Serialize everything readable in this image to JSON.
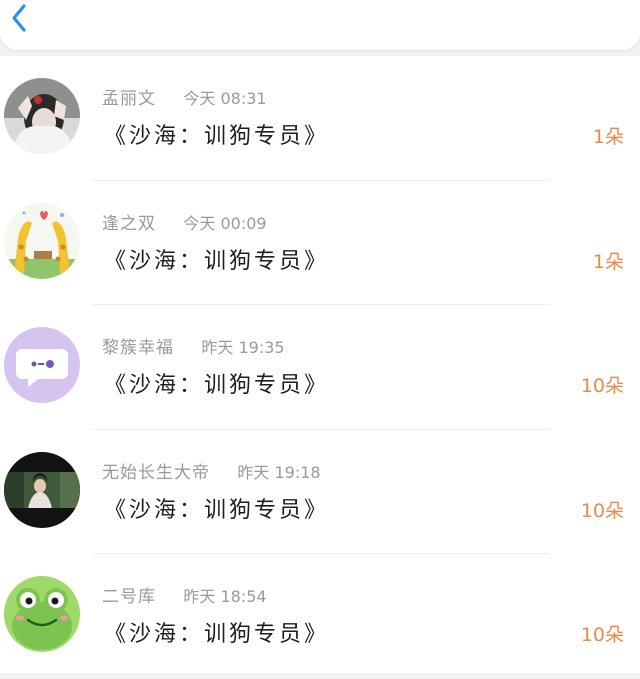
{
  "nav": {
    "back_icon": "chevron-left-icon",
    "accent": "#2c8ef0"
  },
  "messages": [
    {
      "name": "孟丽文",
      "time": "今天 08:31",
      "title": "《沙海：训狗专员》",
      "amount": "1朵",
      "avatar": "selfie-photo"
    },
    {
      "name": "逢之双",
      "time": "今天 00:09",
      "title": "《沙海：训狗专员》",
      "amount": "1朵",
      "avatar": "giraffes-cartoon"
    },
    {
      "name": "黎簇幸福",
      "time": "昨天 19:35",
      "title": "《沙海：训狗专员》",
      "amount": "10朵",
      "avatar": "purple-chat-bubble"
    },
    {
      "name": "无始长生大帝",
      "time": "昨天 19:18",
      "title": "《沙海：训狗专员》",
      "amount": "10朵",
      "avatar": "drama-still-photo"
    },
    {
      "name": "二号库",
      "time": "昨天 18:54",
      "title": "《沙海：训狗专员》",
      "amount": "10朵",
      "avatar": "green-frog-cartoon"
    }
  ],
  "colors": {
    "amount": "#e98a4a",
    "meta": "#9a9a9a",
    "title": "#1e1e1e"
  }
}
